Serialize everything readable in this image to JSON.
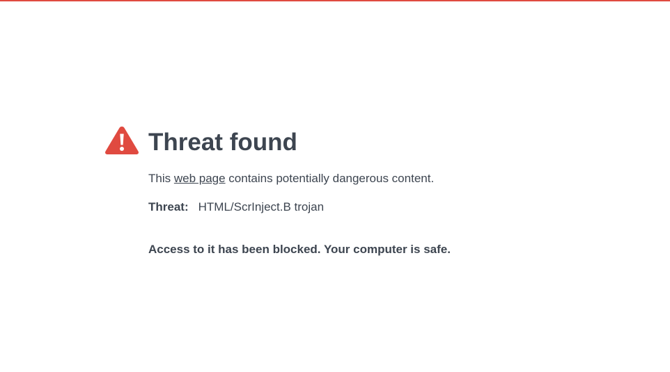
{
  "colors": {
    "accent": "#e04a40",
    "text": "#3d4550",
    "background": "#ffffff"
  },
  "icon": "warning-triangle-icon",
  "title": "Threat found",
  "description": {
    "before": "This ",
    "link": "web page",
    "after": " contains potentially dangerous content."
  },
  "threat": {
    "label": "Threat:",
    "value": "HTML/ScrInject.B trojan"
  },
  "blocked_message": "Access to it has been blocked. Your computer is safe."
}
